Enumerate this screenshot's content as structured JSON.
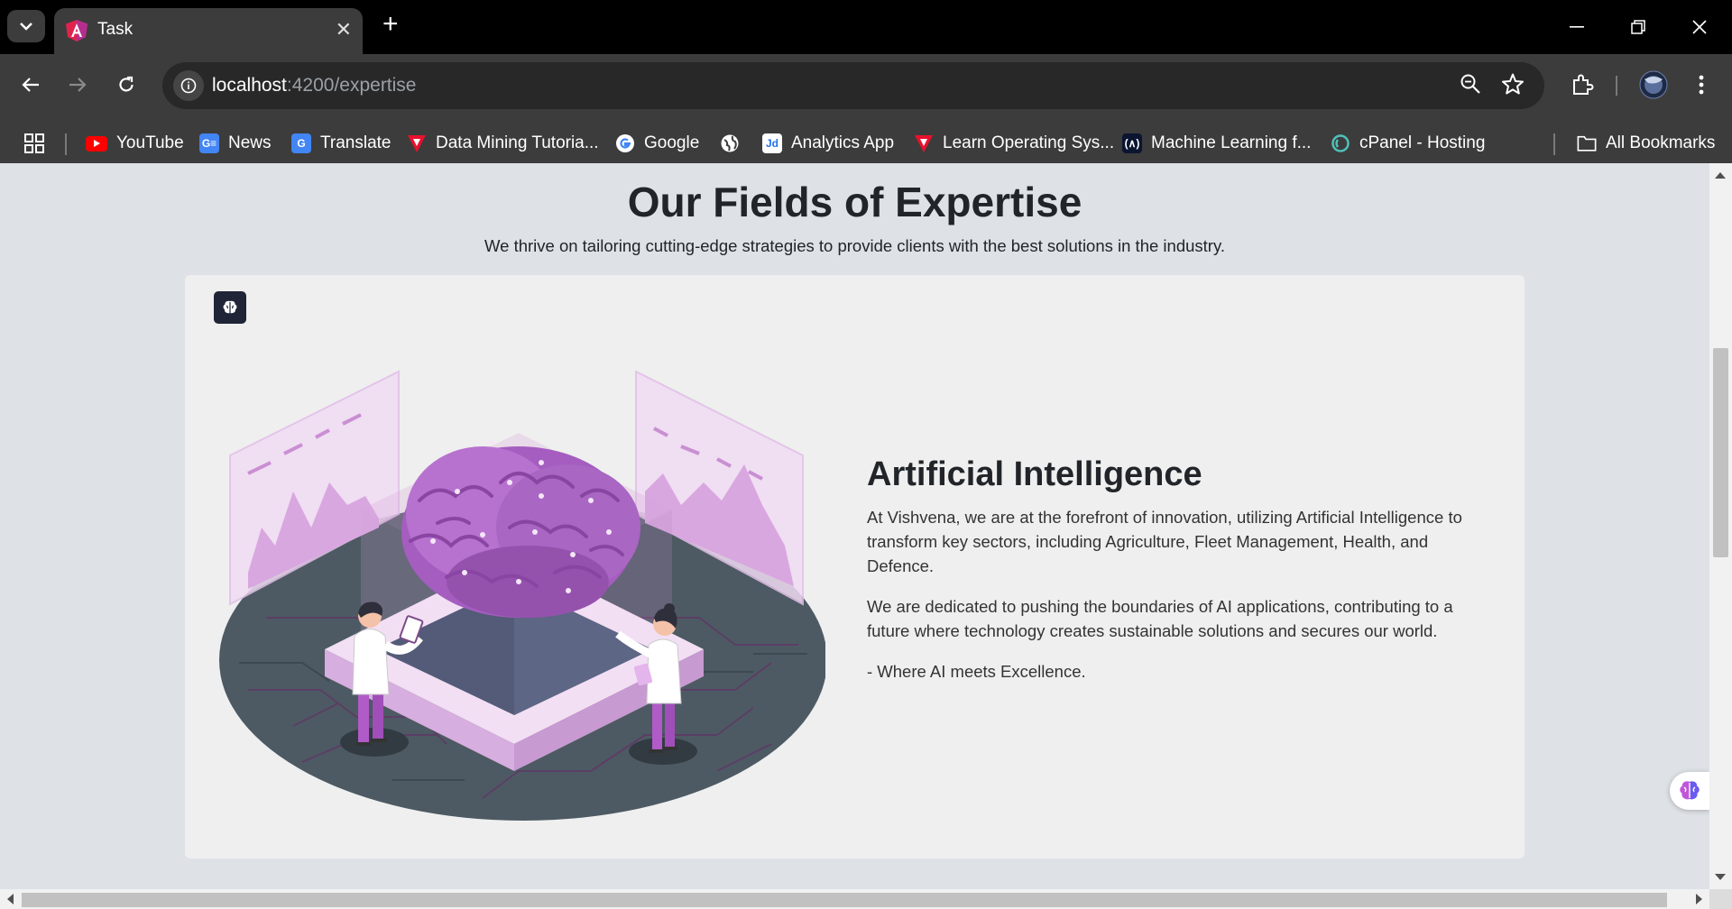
{
  "browser": {
    "tab_title": "Task",
    "url_host": "localhost",
    "url_path": ":4200/expertise",
    "bookmarks": [
      {
        "label": "YouTube",
        "icon": "youtube-icon"
      },
      {
        "label": "News",
        "icon": "google-news-icon"
      },
      {
        "label": "Translate",
        "icon": "google-translate-icon"
      },
      {
        "label": "Data Mining Tutoria...",
        "icon": "tutorialspoint-icon"
      },
      {
        "label": "Google",
        "icon": "google-icon"
      },
      {
        "label": "",
        "icon": "globe-icon"
      },
      {
        "label": "Analytics App",
        "icon": "jd-icon"
      },
      {
        "label": "Learn Operating Sys...",
        "icon": "tutorialspoint-icon"
      },
      {
        "label": "Machine Learning f...",
        "icon": "ml-icon"
      },
      {
        "label": "cPanel - Hosting",
        "icon": "cpanel-icon"
      }
    ],
    "all_bookmarks": "All Bookmarks"
  },
  "page": {
    "title": "Our Fields of Expertise",
    "subtitle": "We thrive on tailoring cutting-edge strategies to provide clients with the best solutions in the industry.",
    "card": {
      "heading": "Artificial Intelligence",
      "paragraph1": "At Vishvena, we are at the forefront of innovation, utilizing Artificial Intelligence to transform key sectors, including Agriculture, Fleet Management, Health, and Defence.",
      "paragraph2": "We are dedicated to pushing the boundaries of AI applications, contributing to a future where technology creates sustainable solutions and secures our world.",
      "tagline": "- Where AI meets Excellence."
    }
  },
  "colors": {
    "page_bg": "#dee2e6",
    "card_bg": "#efefef",
    "accent_purple": "#b76fd1",
    "platform_dark": "#4a5560"
  }
}
